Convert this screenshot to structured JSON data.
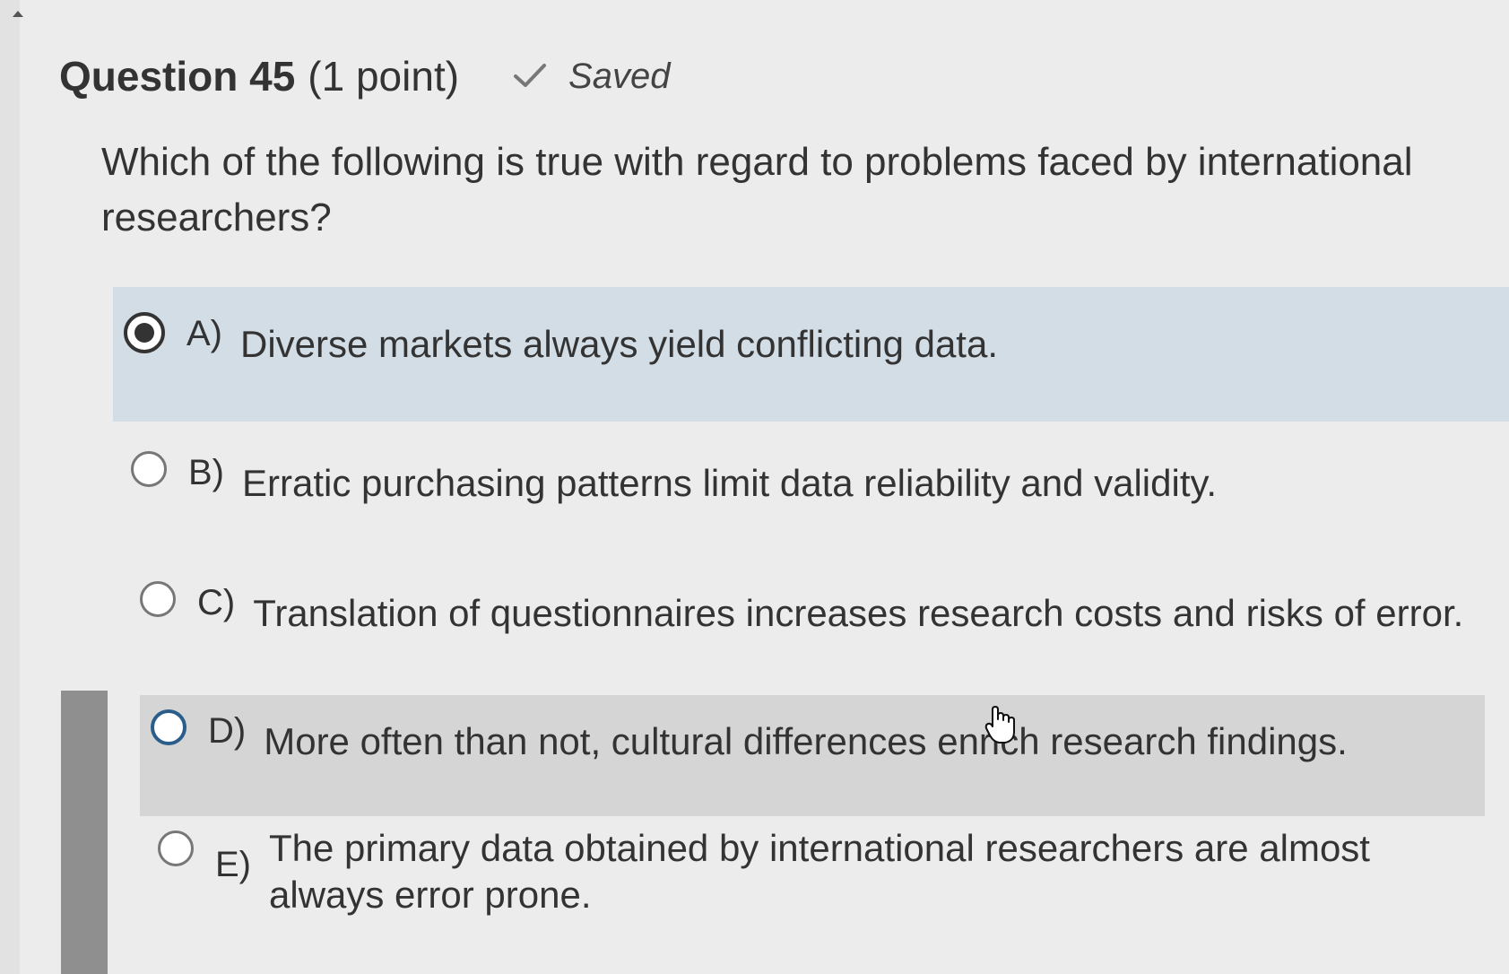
{
  "question": {
    "title": "Question 45",
    "points": "(1 point)",
    "status": "Saved",
    "text": "Which of the following is true with regard to problems faced by international researchers?"
  },
  "options": [
    {
      "letter": "A)",
      "text": "Diverse markets always yield conflicting data.",
      "selected": true
    },
    {
      "letter": "B)",
      "text": "Erratic purchasing patterns limit data reliability and validity.",
      "selected": false
    },
    {
      "letter": "C)",
      "text": "Translation of questionnaires increases research costs and risks of error.",
      "selected": false
    },
    {
      "letter": "D)",
      "text": "More often than not, cultural differences enrich research findings.",
      "selected": false
    },
    {
      "letter": "E)",
      "text": "The primary data obtained by international researchers are almost always error prone.",
      "selected": false
    }
  ],
  "icons": {
    "status_icon": "checkmark-icon",
    "cursor": "hand-pointer-icon",
    "scroll": "scroll-up-arrow-icon"
  },
  "colors": {
    "selected_bg": "#d3dde6",
    "hover_bg": "#d5d5d5",
    "text": "#333333",
    "page_bg": "#ececec"
  }
}
